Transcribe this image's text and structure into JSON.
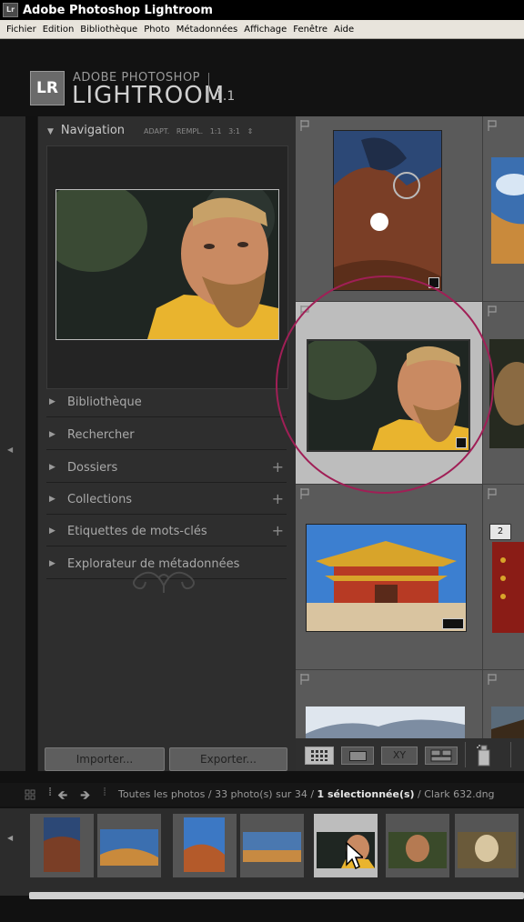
{
  "window": {
    "app_icon": "Lr",
    "title": "Adobe Photoshop Lightroom"
  },
  "menu": [
    "Fichier",
    "Edition",
    "Bibliothèque",
    "Photo",
    "Métadonnées",
    "Affichage",
    "Fenêtre",
    "Aide"
  ],
  "identity": {
    "logo": "LR",
    "line1": "ADOBE PHOTOSHOP",
    "line2": "LIGHTROOM",
    "version": "1.1"
  },
  "navigator": {
    "title": "Navigation",
    "options": [
      "ADAPT.",
      "REMPL.",
      "1:1",
      "3:1"
    ]
  },
  "sections": [
    {
      "label": "Bibliothèque",
      "plus": ""
    },
    {
      "label": "Rechercher",
      "plus": ""
    },
    {
      "label": "Dossiers",
      "plus": "+"
    },
    {
      "label": "Collections",
      "plus": "+"
    },
    {
      "label": "Etiquettes de mots-clés",
      "plus": "+"
    },
    {
      "label": "Explorateur de métadonnées",
      "plus": ""
    }
  ],
  "buttons": {
    "import": "Importer...",
    "export": "Exporter..."
  },
  "grid": {
    "badge_number": "2"
  },
  "toolbar": {
    "compare_label": "XY"
  },
  "filmstrip": {
    "path": "Toutes les photos / 33 photo(s) sur 34 / ",
    "selected": "1 sélectionnée(s)",
    "file": " / Clark 632.dng"
  },
  "colors": {
    "highlight_circle": "#a01f56",
    "selection_bg": "#bdbdbd"
  }
}
